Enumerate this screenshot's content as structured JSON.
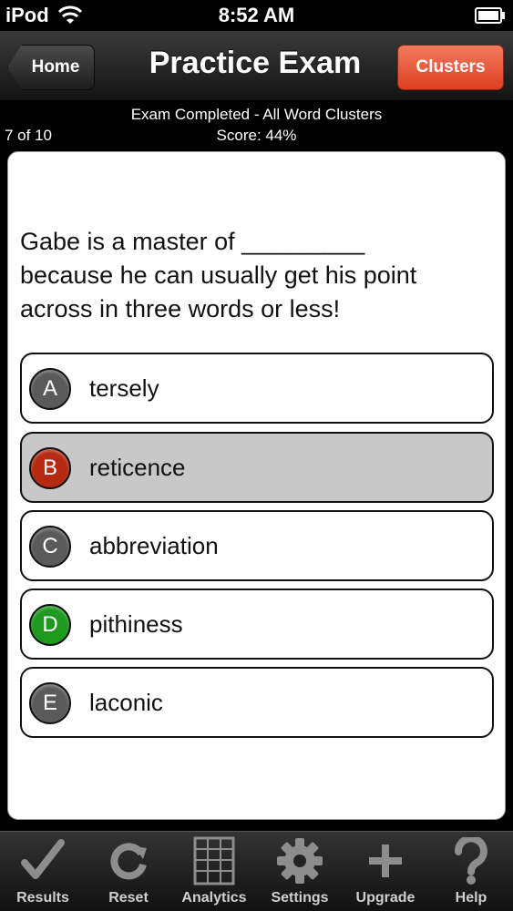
{
  "status_bar": {
    "carrier": "iPod",
    "time": "8:52 AM"
  },
  "nav": {
    "back_label": "Home",
    "title": "Practice Exam",
    "right_label": "Clusters"
  },
  "info": {
    "counter": "7 of 10",
    "status": "Exam Completed - All Word Clusters",
    "score": "Score: 44%"
  },
  "question": {
    "line1": "Gabe is a master of _________",
    "line2": "because he can usually get his point",
    "line3": "across in three words or less!"
  },
  "options": [
    {
      "letter": "A",
      "text": "tersely",
      "badge_color": "#5a5a5a",
      "selected": false
    },
    {
      "letter": "B",
      "text": "reticence",
      "badge_color": "#b52a12",
      "selected": true
    },
    {
      "letter": "C",
      "text": "abbreviation",
      "badge_color": "#5a5a5a",
      "selected": false
    },
    {
      "letter": "D",
      "text": "pithiness",
      "badge_color": "#1e9a1e",
      "selected": false
    },
    {
      "letter": "E",
      "text": "laconic",
      "badge_color": "#5a5a5a",
      "selected": false
    }
  ],
  "tabs": [
    {
      "label": "Results",
      "icon": "checkmark-icon"
    },
    {
      "label": "Reset",
      "icon": "refresh-icon"
    },
    {
      "label": "Analytics",
      "icon": "grid-icon"
    },
    {
      "label": "Settings",
      "icon": "gear-icon"
    },
    {
      "label": "Upgrade",
      "icon": "plus-icon"
    },
    {
      "label": "Help",
      "icon": "question-icon"
    }
  ],
  "colors": {
    "accent_red": "#de3f22",
    "correct_green": "#1e9a1e",
    "wrong_red": "#b52a12"
  }
}
